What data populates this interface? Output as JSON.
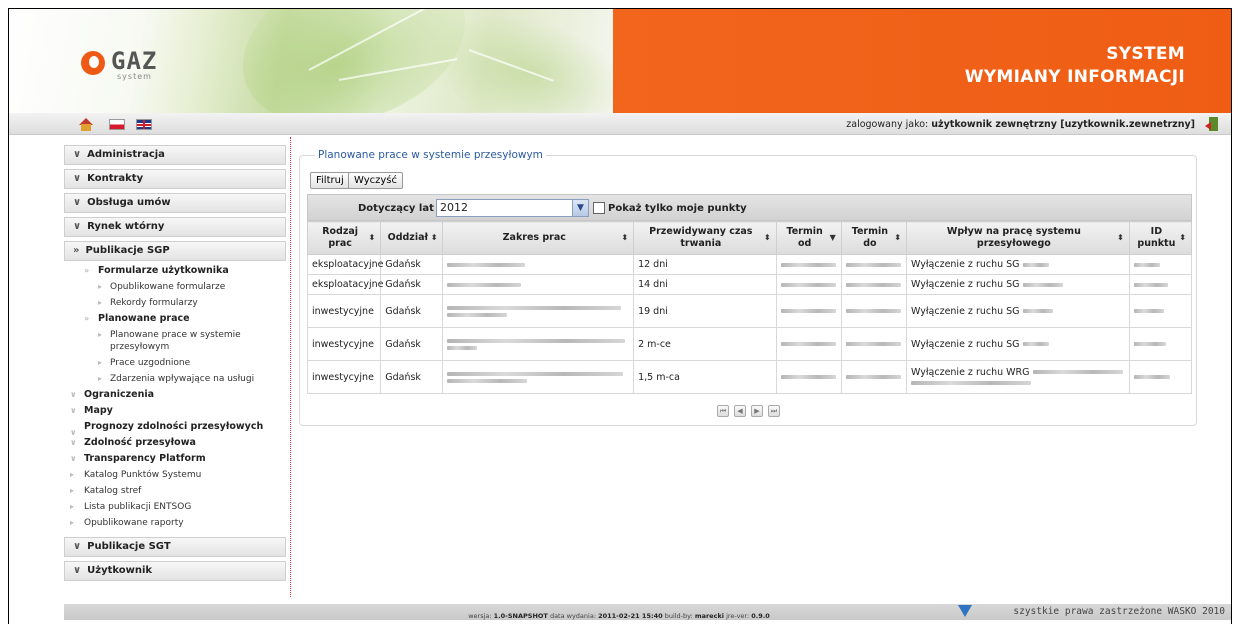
{
  "header": {
    "logo_word": "GAZ",
    "logo_sub": "system",
    "title_line1": "SYSTEM",
    "title_line2": "WYMIANY INFORMACJI"
  },
  "topbar": {
    "login_prefix": "zalogowany jako:",
    "login_user": "użytkownik zewnętrzny [uzytkownik.zewnetrzny]"
  },
  "sidebar": {
    "administracja": "Administracja",
    "kontrakty": "Kontrakty",
    "obsluga_umow": "Obsługa umów",
    "rynek_wtorny": "Rynek wtórny",
    "publikacje_sgp": "Publikacje SGP",
    "formularze_uzytkownika": "Formularze użytkownika",
    "opublikowane_formularze": "Opublikowane formularze",
    "rekordy_formularzy": "Rekordy formularzy",
    "planowane_prace": "Planowane prace",
    "planowane_prace_w_systemie": "Planowane prace w systemie przesyłowym",
    "prace_uzgodnione": "Prace uzgodnione",
    "zdarzenia": "Zdarzenia wpływające na usługi",
    "ograniczenia": "Ograniczenia",
    "mapy": "Mapy",
    "prognozy": "Prognozy zdolności przesyłowych",
    "zdolnosc": "Zdolność przesyłowa",
    "transparency": "Transparency Platform",
    "katalog_punktow": "Katalog Punktów Systemu",
    "katalog_stref": "Katalog stref",
    "lista_entsog": "Lista publikacji ENTSOG",
    "opublikowane_raporty": "Opublikowane raporty",
    "publikacje_sgt": "Publikacje SGT",
    "uzytkownik": "Użytkownik"
  },
  "main": {
    "legend": "Planowane prace w systemie przesyłowym",
    "filter_button": "Filtruj",
    "clear_button": "Wyczyść",
    "year_label": "Dotyczący lat :",
    "year_value": "2012",
    "only_my_points": "Pokaż tylko moje punkty",
    "columns": {
      "rodzaj": "Rodzaj prac",
      "oddzial": "Oddział",
      "zakres": "Zakres prac",
      "czas": "Przewidywany czas trwania",
      "termin_od": "Termin od",
      "termin_do": "Termin do",
      "wplyw": "Wpływ na pracę systemu przesyłowego",
      "id": "ID punktu"
    },
    "rows": [
      {
        "rodzaj": "eksploatacyjne",
        "oddzial": "Gdańsk",
        "czas": "12 dni",
        "wplyw": "Wyłączenie z ruchu SG"
      },
      {
        "rodzaj": "eksploatacyjne",
        "oddzial": "Gdańsk",
        "czas": "14 dni",
        "wplyw": "Wyłączenie z ruchu SG"
      },
      {
        "rodzaj": "inwestycyjne",
        "oddzial": "Gdańsk",
        "czas": "19 dni",
        "wplyw": "Wyłączenie z ruchu SG"
      },
      {
        "rodzaj": "inwestycyjne",
        "oddzial": "Gdańsk",
        "czas": "2 m-ce",
        "wplyw": "Wyłączenie z ruchu SG"
      },
      {
        "rodzaj": "inwestycyjne",
        "oddzial": "Gdańsk",
        "czas": "1,5 m-ca",
        "wplyw": "Wyłączenie z ruchu WRG"
      }
    ]
  },
  "footer": {
    "copyright": "szystkie prawa zastrzeżone WASKO 2010",
    "version_label": "wersja:",
    "version": "1.0-SNAPSHOT",
    "date_label": "data wydania:",
    "date": "2011-02-21 15:40",
    "build_label": "build-by:",
    "build": "marecki",
    "jre_label": "jre-ver:",
    "jre": "0.9.0"
  },
  "colors": {
    "brand_orange": "#f2651d",
    "link_blue": "#2b5aa0"
  }
}
